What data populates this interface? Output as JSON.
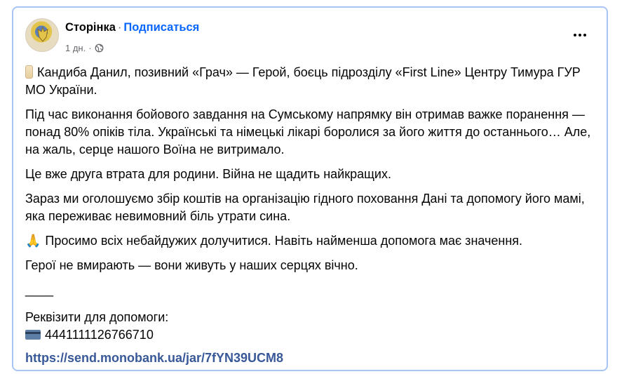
{
  "post": {
    "author": "Сторінка",
    "separator": "·",
    "follow_label": "Подписаться",
    "time": "1 дн.",
    "time_separator": "·",
    "audience_icon": "globe-icon",
    "more_icon": "more-options-icon"
  },
  "content": {
    "p1": "Кандиба Данил, позивний «Грач» — Герой, боєць підрозділу «First Line» Центру Тимура ГУР МО України.",
    "p2": "Під час виконання бойового завдання на Сумському напрямку він отримав важке поранення — понад 80% опіків тіла. Українські та німецькі лікарі боролися за його життя до останнього… Але, на жаль, серце нашого Воїна не витримало.",
    "p3": "Це вже друга втрата для родини. Війна не щадить найкращих.",
    "p4": "Зараз ми оголошуємо збір коштів на організацію гідного поховання Дані та допомогу його мамі, яка переживає невимовний біль утрати сина.",
    "p5_emoji": "🙏",
    "p5": "Просимо всіх небайдужих долучитися. Навіть найменша допомога має значення.",
    "p6": "Герої не вмирають — вони живуть у наших серцях вічно.",
    "divider": "____",
    "requisites_label": "Реквізити для допомоги:",
    "card_number": "4441111126766710",
    "link": "https://send.monobank.ua/jar/7fYN39UCM8"
  }
}
